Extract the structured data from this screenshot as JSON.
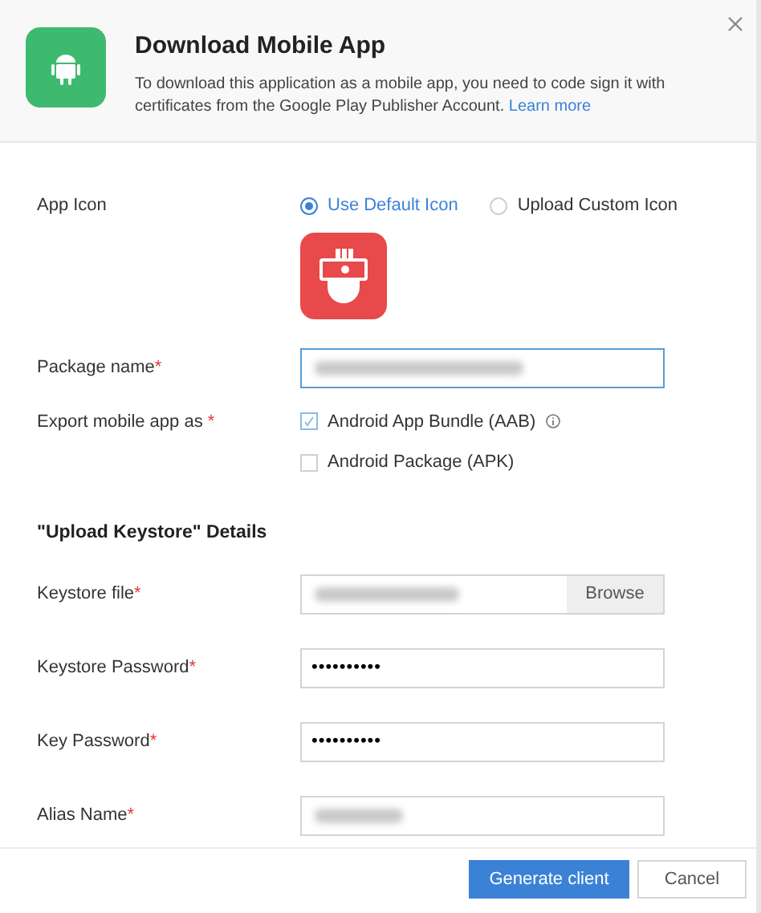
{
  "header": {
    "title": "Download Mobile App",
    "description": "To download this application as a mobile app, you need to code sign it with certificates from the Google Play Publisher Account.",
    "link": "Learn more"
  },
  "app_icon": {
    "label": "App Icon",
    "options": [
      {
        "label": "Use Default Icon",
        "selected": true
      },
      {
        "label": "Upload Custom Icon",
        "selected": false
      }
    ]
  },
  "package_name": {
    "label": "Package name",
    "required_mark": "*",
    "kind": "blurred",
    "focused": true
  },
  "export": {
    "label": "Export mobile app as",
    "required_mark": "*",
    "options": [
      {
        "label": "Android App Bundle (AAB)",
        "checked": true,
        "info": true
      },
      {
        "label": "Android Package (APK)",
        "checked": false
      }
    ]
  },
  "section_title": "\"Upload Keystore\" Details",
  "fields": [
    {
      "label": "Keystore file",
      "required_mark": "*",
      "kind": "file",
      "button": "Browse",
      "focused": false
    },
    {
      "label": "Keystore Password",
      "required_mark": "*",
      "kind": "password",
      "value": "••••••••••",
      "focused": false
    },
    {
      "label": "Key Password",
      "required_mark": "*",
      "kind": "password",
      "value": "••••••••••",
      "focused": false
    },
    {
      "label": "Alias Name",
      "required_mark": "*",
      "kind": "blurred",
      "focused": false
    }
  ],
  "buttons": [
    {
      "label": "Generate client",
      "kind": "primary"
    },
    {
      "label": "Cancel",
      "kind": "secondary"
    }
  ]
}
